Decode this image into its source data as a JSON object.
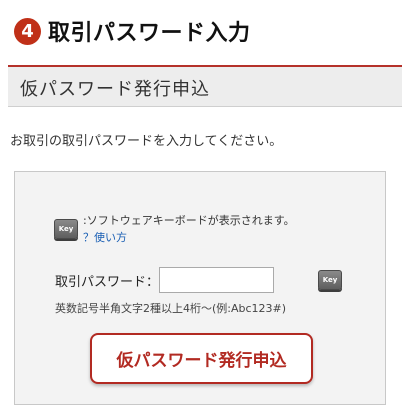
{
  "step": {
    "number": "4",
    "title": "取引パスワード入力"
  },
  "section": {
    "title": "仮パスワード発行申込"
  },
  "intro_text": "お取引の取引パスワードを入力してください。",
  "keyboard": {
    "icon_label": "Key",
    "note": ":ソフトウェアキーボードが表示されます。",
    "howto_link": "？使い方"
  },
  "form": {
    "password_label": "取引パスワード：",
    "password_value": "",
    "hint": "英数記号半角文字2種以上4桁～(例:Abc123#)"
  },
  "submit_label": "仮パスワード発行申込",
  "colors": {
    "accent": "#b22a22",
    "badge": "#c03018",
    "link": "#1a5fb4",
    "panel_bg": "#f3f3f3"
  }
}
